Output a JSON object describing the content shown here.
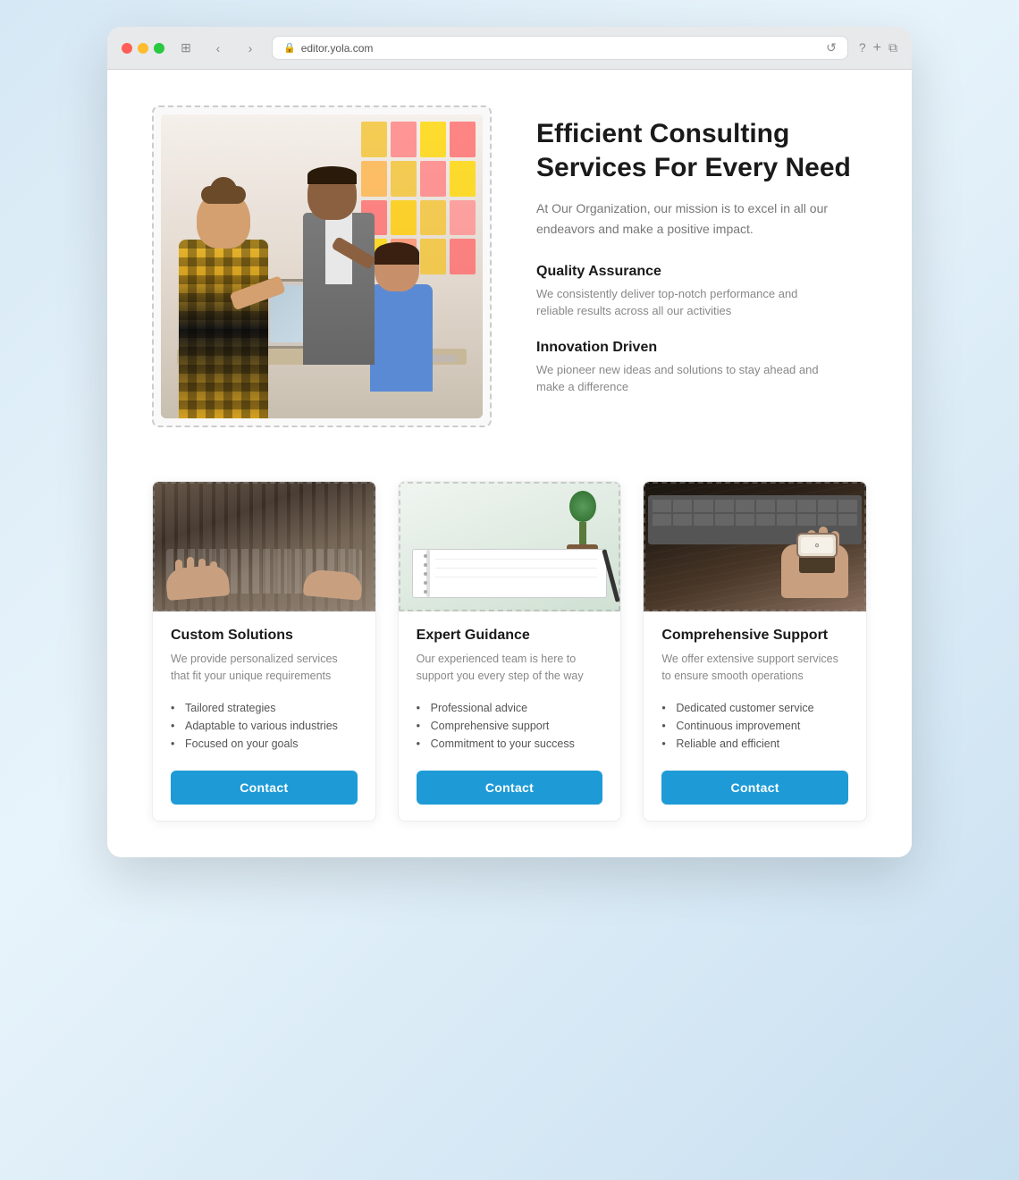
{
  "browser": {
    "url": "editor.yola.com",
    "back_label": "‹",
    "forward_label": "›",
    "grid_label": "⊞",
    "reload_label": "↺"
  },
  "hero": {
    "title": "Efficient Consulting Services For Every Need",
    "subtitle": "At Our Organization, our mission is to excel in all our endeavors and make a positive impact.",
    "features": [
      {
        "title": "Quality Assurance",
        "desc": "We consistently deliver top-notch performance and reliable results across all our activities"
      },
      {
        "title": "Innovation Driven",
        "desc": "We pioneer new ideas and solutions to stay ahead and make a difference"
      }
    ]
  },
  "cards": [
    {
      "id": "custom-solutions",
      "title": "Custom Solutions",
      "desc": "We provide personalized services that fit your unique requirements",
      "list": [
        "Tailored strategies",
        "Adaptable to various industries",
        "Focused on your goals"
      ],
      "button_label": "Contact"
    },
    {
      "id": "expert-guidance",
      "title": "Expert Guidance",
      "desc": "Our experienced team is here to support you every step of the way",
      "list": [
        "Professional advice",
        "Comprehensive support",
        "Commitment to your success"
      ],
      "button_label": "Contact"
    },
    {
      "id": "comprehensive-support",
      "title": "Comprehensive Support",
      "desc": "We offer extensive support services to ensure smooth operations",
      "list": [
        "Dedicated customer service",
        "Continuous improvement",
        "Reliable and efficient"
      ],
      "button_label": "Contact"
    }
  ],
  "sticky_notes": {
    "colors": [
      "#f4c430",
      "#ff9090",
      "#ff6b6b",
      "#ffd700",
      "#ffb347",
      "#ff8c69",
      "#ffa07a",
      "#ffd700",
      "#ff7f7f",
      "#ffcc00",
      "#ff6347",
      "#ffdb4d",
      "#ffc04d",
      "#ff8c69",
      "#ff9090",
      "#ffd700",
      "#ffa500",
      "#ff6b6b",
      "#ffd700",
      "#ff7f50"
    ]
  }
}
